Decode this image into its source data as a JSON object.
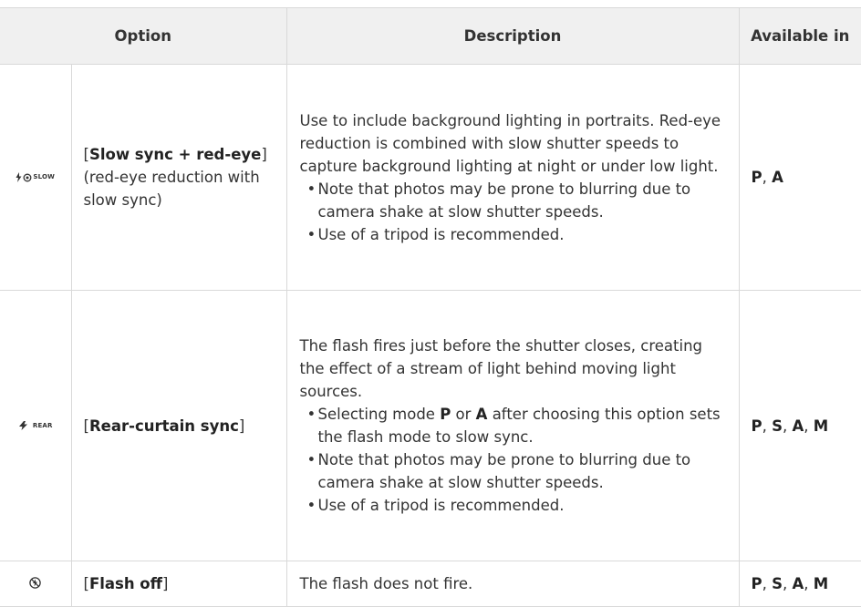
{
  "headers": {
    "option": "Option",
    "description": "Description",
    "available": "Available in"
  },
  "rows": [
    {
      "icon_name": "flash-redeye-slow-icon",
      "icon_tag": "SLOW",
      "option_pre": "[",
      "option_bold": "Slow sync + red-eye",
      "option_post": "]",
      "option_sub": "(red-eye reduction with slow sync)",
      "desc": "Use to include background lighting in portraits. Red-eye reduction is combined with slow shutter speeds to capture background lighting at night or under low light.",
      "bullets": [
        "Note that photos may be prone to blurring due to camera shake at slow shutter speeds.",
        "Use of a tripod is recommended."
      ],
      "modes": [
        "P",
        "A"
      ]
    },
    {
      "icon_name": "flash-rear-icon",
      "icon_tag": "REAR",
      "option_pre": "[",
      "option_bold": "Rear-curtain sync",
      "option_post": "]",
      "desc": "The flash fires just before the shutter closes, creating the effect of a stream of light behind moving light sources.",
      "bullet_mode": {
        "pre": "Selecting mode ",
        "m1": "P",
        "mid": " or ",
        "m2": "A",
        "post": " after choosing this option sets the flash mode to slow sync."
      },
      "bullets": [
        "Note that photos may be prone to blurring due to camera shake at slow shutter speeds.",
        "Use of a tripod is recommended."
      ],
      "modes": [
        "P",
        "S",
        "A",
        "M"
      ]
    },
    {
      "icon_name": "flash-off-icon",
      "option_pre": "[",
      "option_bold": "Flash off",
      "option_post": "]",
      "desc": "The flash does not fire.",
      "modes": [
        "P",
        "S",
        "A",
        "M"
      ]
    }
  ],
  "sep": ", "
}
